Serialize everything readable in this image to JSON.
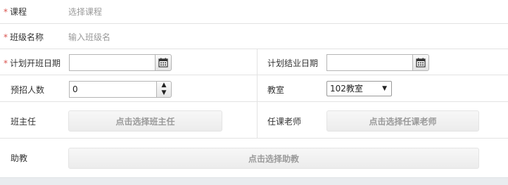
{
  "form": {
    "course": {
      "label": "课程",
      "required": true,
      "placeholder": "选择课程"
    },
    "class_name": {
      "label": "班级名称",
      "required": true,
      "placeholder": "输入班级名"
    },
    "start_date": {
      "label": "计划开班日期",
      "required": true,
      "value": "",
      "icon": "calendar-icon"
    },
    "end_date": {
      "label": "计划结业日期",
      "required": false,
      "value": "",
      "icon": "calendar-icon"
    },
    "enrollment": {
      "label": "预招人数",
      "value": "0",
      "up_glyph": "▲",
      "down_glyph": "▼"
    },
    "classroom": {
      "label": "教室",
      "selected": "102教室",
      "caret": "▼"
    },
    "head_teacher": {
      "label": "班主任",
      "button": "点击选择班主任"
    },
    "teachers": {
      "label": "任课老师",
      "button": "点击选择任课老师"
    },
    "assistant": {
      "label": "助教",
      "button": "点击选择助教"
    }
  },
  "required_mark": "*",
  "colors": {
    "required": "#d9534f",
    "label": "#333333",
    "placeholder": "#9a9a9a",
    "border": "#e3e3e3"
  }
}
